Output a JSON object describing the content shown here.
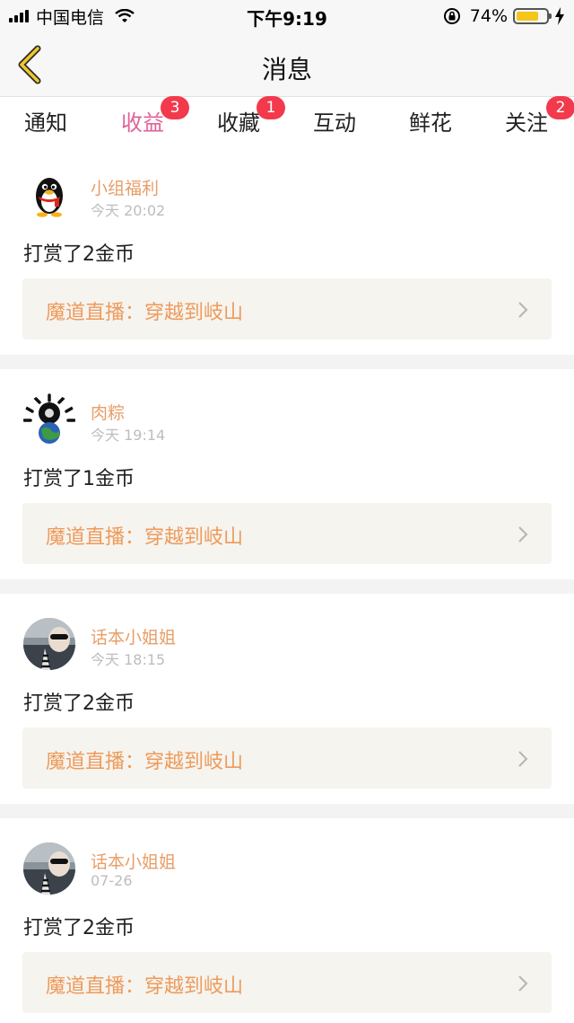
{
  "status_bar": {
    "carrier": "中国电信",
    "time": "下午9:19",
    "battery_percent": "74%",
    "battery_level": 0.74,
    "signal_icon": "signal-bars-icon",
    "wifi_icon": "wifi-icon",
    "lock_icon": "orientation-lock-icon",
    "charging_icon": "bolt-icon"
  },
  "nav": {
    "title": "消息",
    "back_icon": "chevron-left-icon"
  },
  "colors": {
    "accent": "#e0629a",
    "badge": "#f23a4c",
    "username": "#e79e68",
    "link_text": "#ef9a5a",
    "link_bg": "#f5f4ef",
    "back_arrow": "#f2c72b"
  },
  "tabs": [
    {
      "label": "通知",
      "badge": ""
    },
    {
      "label": "收益",
      "badge": "3",
      "active": true
    },
    {
      "label": "收藏",
      "badge": "1"
    },
    {
      "label": "互动",
      "badge": ""
    },
    {
      "label": "鲜花",
      "badge": ""
    },
    {
      "label": "关注",
      "badge": "2"
    }
  ],
  "messages": [
    {
      "username": "小组福利",
      "time": "今天 20:02",
      "text": "打赏了2金币",
      "link": "魔道直播：穿越到岐山",
      "avatar": "penguin-avatar"
    },
    {
      "username": "肉粽",
      "time": "今天 19:14",
      "text": "打赏了1金币",
      "link": "魔道直播：穿越到岐山",
      "avatar": "globe-avatar"
    },
    {
      "username": "话本小姐姐",
      "time": "今天 18:15",
      "text": "打赏了2金币",
      "link": "魔道直播：穿越到岐山",
      "avatar": "photo-avatar"
    },
    {
      "username": "话本小姐姐",
      "time": "07-26",
      "text": "打赏了2金币",
      "link": "魔道直播：穿越到岐山",
      "avatar": "photo-avatar"
    }
  ]
}
